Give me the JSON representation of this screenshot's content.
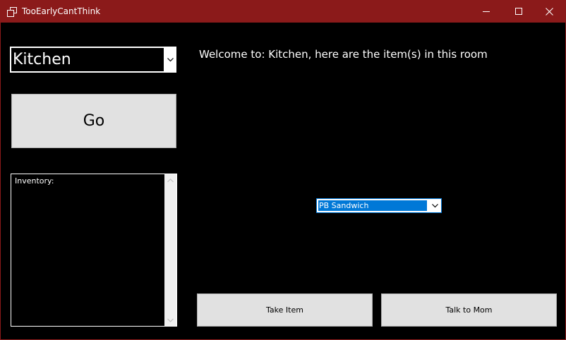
{
  "window": {
    "title": "TooEarlyCantThink",
    "titlebar_color": "#8b1a1a",
    "background_color": "#000000",
    "icons": {
      "app": "app-window-icon",
      "minimize": "minimize-icon",
      "maximize": "maximize-icon",
      "close": "close-icon"
    }
  },
  "room_select": {
    "selected": "Kitchen",
    "icon": "chevron-down-icon"
  },
  "go_button": {
    "label": "Go"
  },
  "inventory": {
    "label": "Inventory:",
    "items": []
  },
  "welcome": {
    "text": "Welcome to: Kitchen, here are the item(s) in this room"
  },
  "item_select": {
    "selected": "PB Sandwich",
    "highlight_color": "#0078d7",
    "icon": "chevron-down-icon"
  },
  "buttons": {
    "take_item": "Take Item",
    "talk_to_mom": "Talk to Mom"
  }
}
